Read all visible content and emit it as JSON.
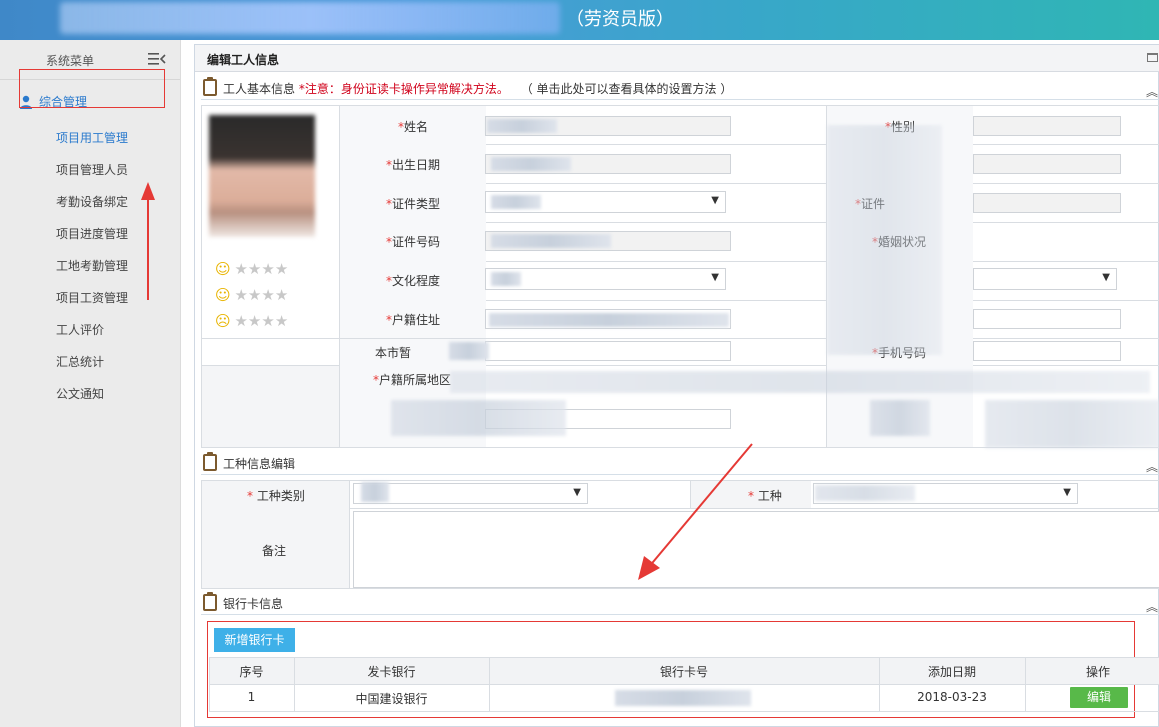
{
  "header": {
    "edition": "（劳资员版）"
  },
  "sidebar": {
    "title": "系统菜单",
    "group": "综合管理",
    "items": [
      {
        "label": "项目用工管理"
      },
      {
        "label": "项目管理人员"
      },
      {
        "label": "考勤设备绑定"
      },
      {
        "label": "项目进度管理"
      },
      {
        "label": "工地考勤管理"
      },
      {
        "label": "项目工资管理"
      },
      {
        "label": "工人评价"
      },
      {
        "label": "汇总统计"
      },
      {
        "label": "公文通知"
      }
    ]
  },
  "panel": {
    "title": "编辑工人信息"
  },
  "basic": {
    "heading": "工人基本信息",
    "notice": "*注意：身份证读卡操作异常解决方法。",
    "hint": "（ 单击此处可以查看具体的设置方法 ）",
    "fields": {
      "name": "姓名",
      "gender": "性别",
      "birth": "出生日期",
      "id_type": "证件类型",
      "id_partial": "证件",
      "id_number": "证件号码",
      "marriage": "婚姻状况",
      "education": "文化程度",
      "household_addr": "户籍住址",
      "temp_addr": "本市暂",
      "phone": "手机号码",
      "household_region": "户籍所属地区"
    },
    "ratings": [
      "☺",
      "☺",
      "☹"
    ]
  },
  "trade": {
    "heading": "工种信息编辑",
    "category_label": "工种类别",
    "trade_label": "工种",
    "remark_label": "备注"
  },
  "bank": {
    "heading": "银行卡信息",
    "add_button": "新增银行卡",
    "columns": [
      "序号",
      "发卡银行",
      "银行卡号",
      "添加日期",
      "操作"
    ],
    "rows": [
      {
        "index": "1",
        "bank": "中国建设银行",
        "date": "2018-03-23",
        "action": "编辑"
      }
    ]
  },
  "colors": {
    "accent": "#3eb0e8",
    "danger": "#e53935",
    "success": "#58b949"
  }
}
